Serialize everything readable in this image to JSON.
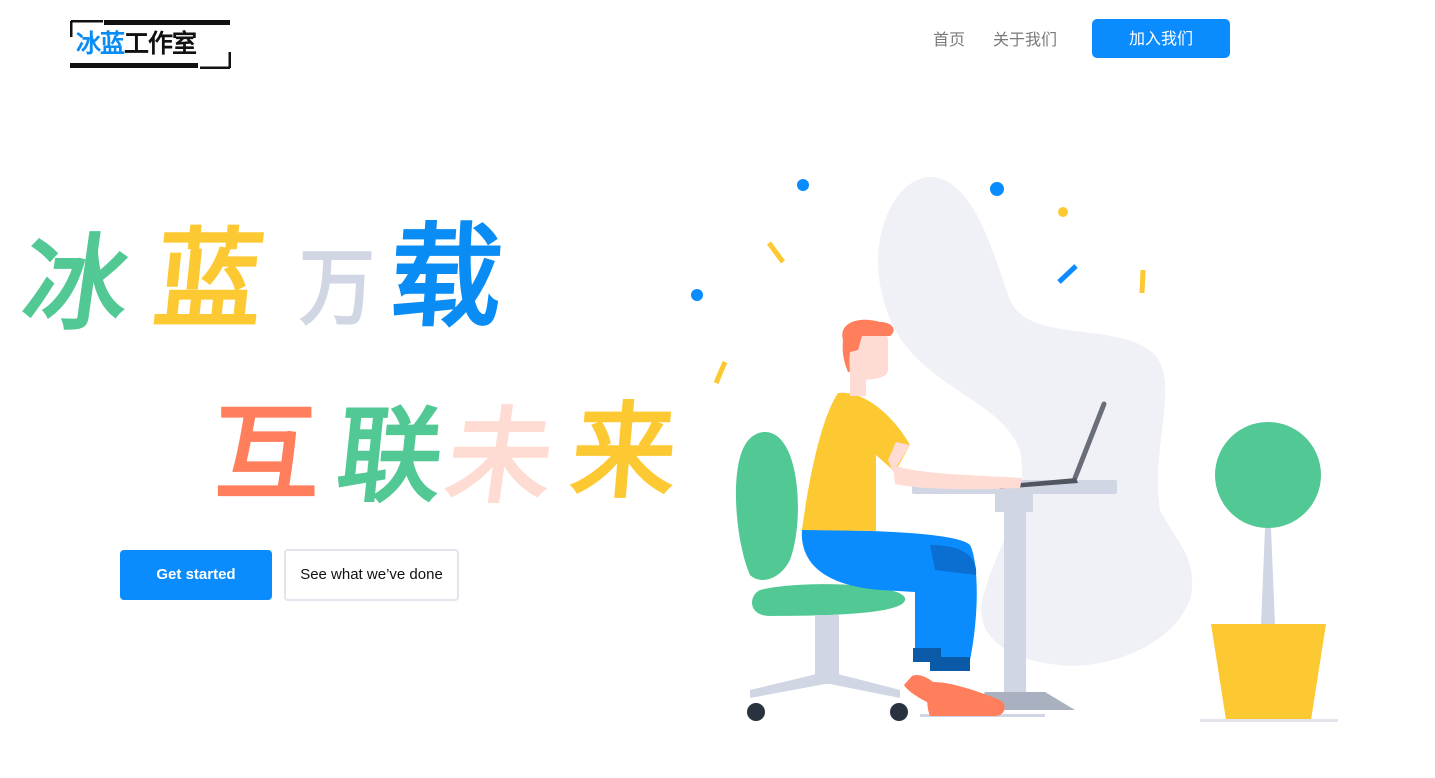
{
  "header": {
    "logo": {
      "part1": "冰蓝",
      "part2": "工作室"
    },
    "nav": {
      "home": "首页",
      "about": "关于我们",
      "join": "加入我们"
    }
  },
  "hero": {
    "headline": {
      "line1": [
        "冰",
        "蓝",
        "万",
        "载"
      ],
      "line2": [
        "互",
        "联",
        "未",
        "来"
      ]
    },
    "cta_primary": "Get started",
    "cta_secondary": "See what we’ve done"
  },
  "colors": {
    "brand_blue": "#0a8cff",
    "green": "#52c994",
    "yellow": "#fdc933",
    "coral": "#ff7e5c",
    "pink": "#ffdcd3",
    "grey": "#d1d6e4"
  },
  "illustration": {
    "description_icon": "person-at-desk-illustration",
    "plant_icon": "potted-tree-icon"
  }
}
